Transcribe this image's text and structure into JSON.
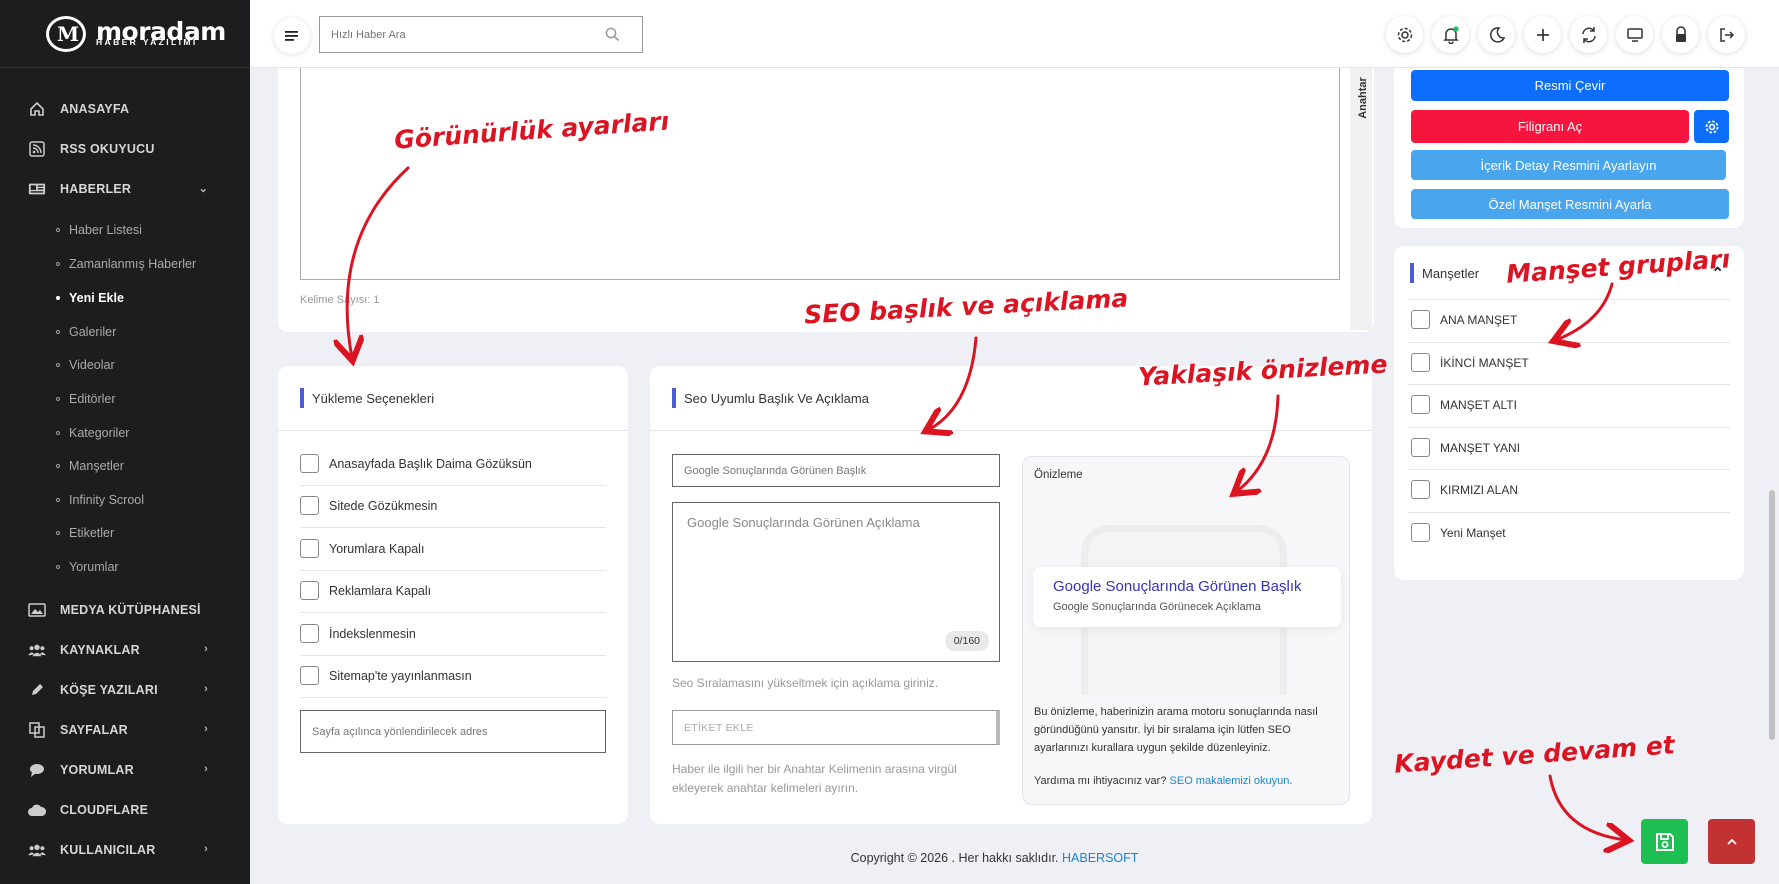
{
  "brand": {
    "name": "moradam",
    "sub": "HABER YAZILIMI"
  },
  "sidebar": {
    "items": [
      {
        "label": "ANASAYFA",
        "icon": "home-icon"
      },
      {
        "label": "RSS OKUYUCU",
        "icon": "rss-icon"
      },
      {
        "label": "HABERLER",
        "icon": "newspaper-icon"
      },
      {
        "label": "MEDYA KÜTÜPHANESİ",
        "icon": "image-icon"
      },
      {
        "label": "KAYNAKLAR",
        "icon": "users-icon"
      },
      {
        "label": "KÖŞE YAZILARI",
        "icon": "pen-icon"
      },
      {
        "label": "SAYFALAR",
        "icon": "pages-icon"
      },
      {
        "label": "YORUMLAR",
        "icon": "comment-icon"
      },
      {
        "label": "CLOUDFLARE",
        "icon": "cloud-icon"
      },
      {
        "label": "KULLANICILAR",
        "icon": "users-icon"
      }
    ],
    "sub_items": [
      "Haber Listesi",
      "Zamanlanmış Haberler",
      "Yeni Ekle",
      "Galeriler",
      "Videolar",
      "Editörler",
      "Kategoriler",
      "Manşetler",
      "Infinity Scrool",
      "Etiketler",
      "Yorumlar"
    ],
    "active_sub": "Yeni Ekle"
  },
  "topbar": {
    "search_placeholder": "Hızlı Haber Ara"
  },
  "editor": {
    "word_count": "Kelime Sayısı: 1",
    "side_tab": "Anahtar"
  },
  "upload_options": {
    "title": "Yükleme Seçenekleri",
    "options": [
      "Anasayfada Başlık Daima Gözüksün",
      "Sitede Gözükmesin",
      "Yorumlara Kapalı",
      "Reklamlara Kapalı",
      "İndekslenmesin",
      "Sitemap'te yayınlanmasın"
    ],
    "redirect_placeholder": "Sayfa açılınca yönlendirilecek adres"
  },
  "seo": {
    "title": "Seo Uyumlu Başlık Ve Açıklama",
    "title_placeholder": "Google Sonuçlarında Görünen Başlık",
    "desc_placeholder": "Google Sonuçlarında Görünen Açıklama",
    "counter": "0/160",
    "desc_hint": "Seo Sıralamasını yükseltmek için açıklama giriniz.",
    "tag_placeholder": "ETİKET EKLE",
    "tag_hint": "Haber ile ilgili her bir Anahtar Kelimenin arasına virgül ekleyerek anahtar kelimeleri ayırın."
  },
  "preview": {
    "label": "Önizleme",
    "result_title": "Google Sonuçlarında Görünen Başlık",
    "result_desc": "Google Sonuçlarında Görünecek Açıklama",
    "info": "Bu önizleme, haberinizin arama motoru sonuçlarında nasıl göründüğünü yansıtır. İyi bir sıralama için lütfen SEO ayarlarınızı kurallara uygun şekilde düzenleyiniz.",
    "help_text": "Yardıma mı ihtiyacınız var?",
    "help_link": "SEO makalemizi okuyun."
  },
  "image_actions": {
    "translate": "Resmi Çevir",
    "watermark": "Filigranı Aç",
    "detail": "İçerik Detay Resmini Ayarlayın",
    "headline_img": "Özel Manşet Resmini Ayarla"
  },
  "headlines": {
    "title": "Manşetler",
    "groups": [
      "ANA MANŞET",
      "İKİNCİ MANŞET",
      "MANŞET ALTI",
      "MANŞET YANI",
      "KIRMIZI ALAN",
      "Yeni Manşet"
    ]
  },
  "annotations": {
    "visibility": "Görünürlük ayarları",
    "seo": "SEO başlık ve açıklama",
    "preview": "Yaklaşık önizleme",
    "groups": "Manşet grupları",
    "save": "Kaydet ve devam et"
  },
  "footer": {
    "text": "Copyright © 2026 . Her hakkı saklıdır.",
    "brand": "HABERSOFT"
  },
  "colors": {
    "blue": "#0d6efd",
    "red": "#f5153f",
    "light_blue": "#49a6ee",
    "accent": "#4b5bd6",
    "save_green": "#1dbe52",
    "top_red": "#c23232"
  }
}
